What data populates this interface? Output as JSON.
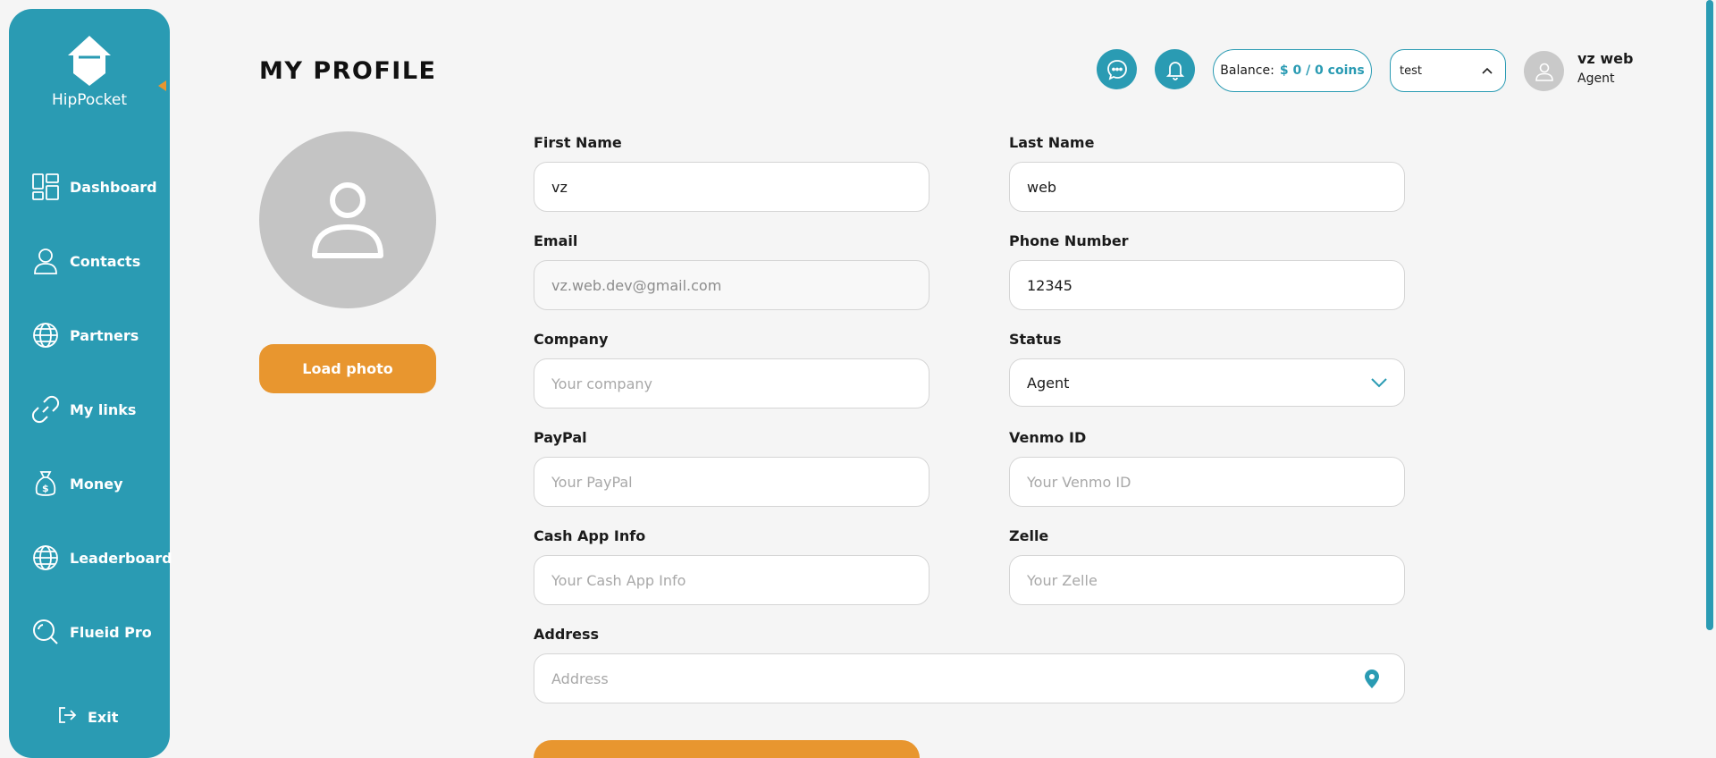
{
  "app": {
    "name": "HipPocket"
  },
  "sidebar": {
    "items": [
      {
        "label": "Dashboard",
        "icon": "dashboard-icon"
      },
      {
        "label": "Contacts",
        "icon": "contacts-icon"
      },
      {
        "label": "Partners",
        "icon": "partners-icon"
      },
      {
        "label": "My links",
        "icon": "link-icon"
      },
      {
        "label": "Money",
        "icon": "money-bag-icon"
      },
      {
        "label": "Leaderboard",
        "icon": "leaderboard-icon"
      },
      {
        "label": "Flueid Pro",
        "icon": "search-icon"
      }
    ],
    "exit_label": "Exit"
  },
  "header": {
    "title": "MY PROFILE",
    "balance_label": "Balance:",
    "balance_value": "$ 0 / 0 coins",
    "select_value": "test",
    "user_name": "vz web",
    "user_role": "Agent"
  },
  "photo": {
    "load_label": "Load photo"
  },
  "form": {
    "first_name": {
      "label": "First Name",
      "value": "vz"
    },
    "last_name": {
      "label": "Last Name",
      "value": "web"
    },
    "email": {
      "label": "Email",
      "value": "vz.web.dev@gmail.com"
    },
    "phone": {
      "label": "Phone Number",
      "value": "12345"
    },
    "company": {
      "label": "Company",
      "placeholder": "Your company"
    },
    "status": {
      "label": "Status",
      "value": "Agent"
    },
    "paypal": {
      "label": "PayPal",
      "placeholder": "Your PayPal"
    },
    "venmo": {
      "label": "Venmo ID",
      "placeholder": "Your Venmo ID"
    },
    "cashapp": {
      "label": "Cash App Info",
      "placeholder": "Your Cash App Info"
    },
    "zelle": {
      "label": "Zelle",
      "placeholder": "Your Zelle"
    },
    "address": {
      "label": "Address",
      "placeholder": "Address"
    }
  },
  "colors": {
    "primary": "#2a9bb3",
    "accent": "#e8962f",
    "background": "#f5f5f5"
  }
}
